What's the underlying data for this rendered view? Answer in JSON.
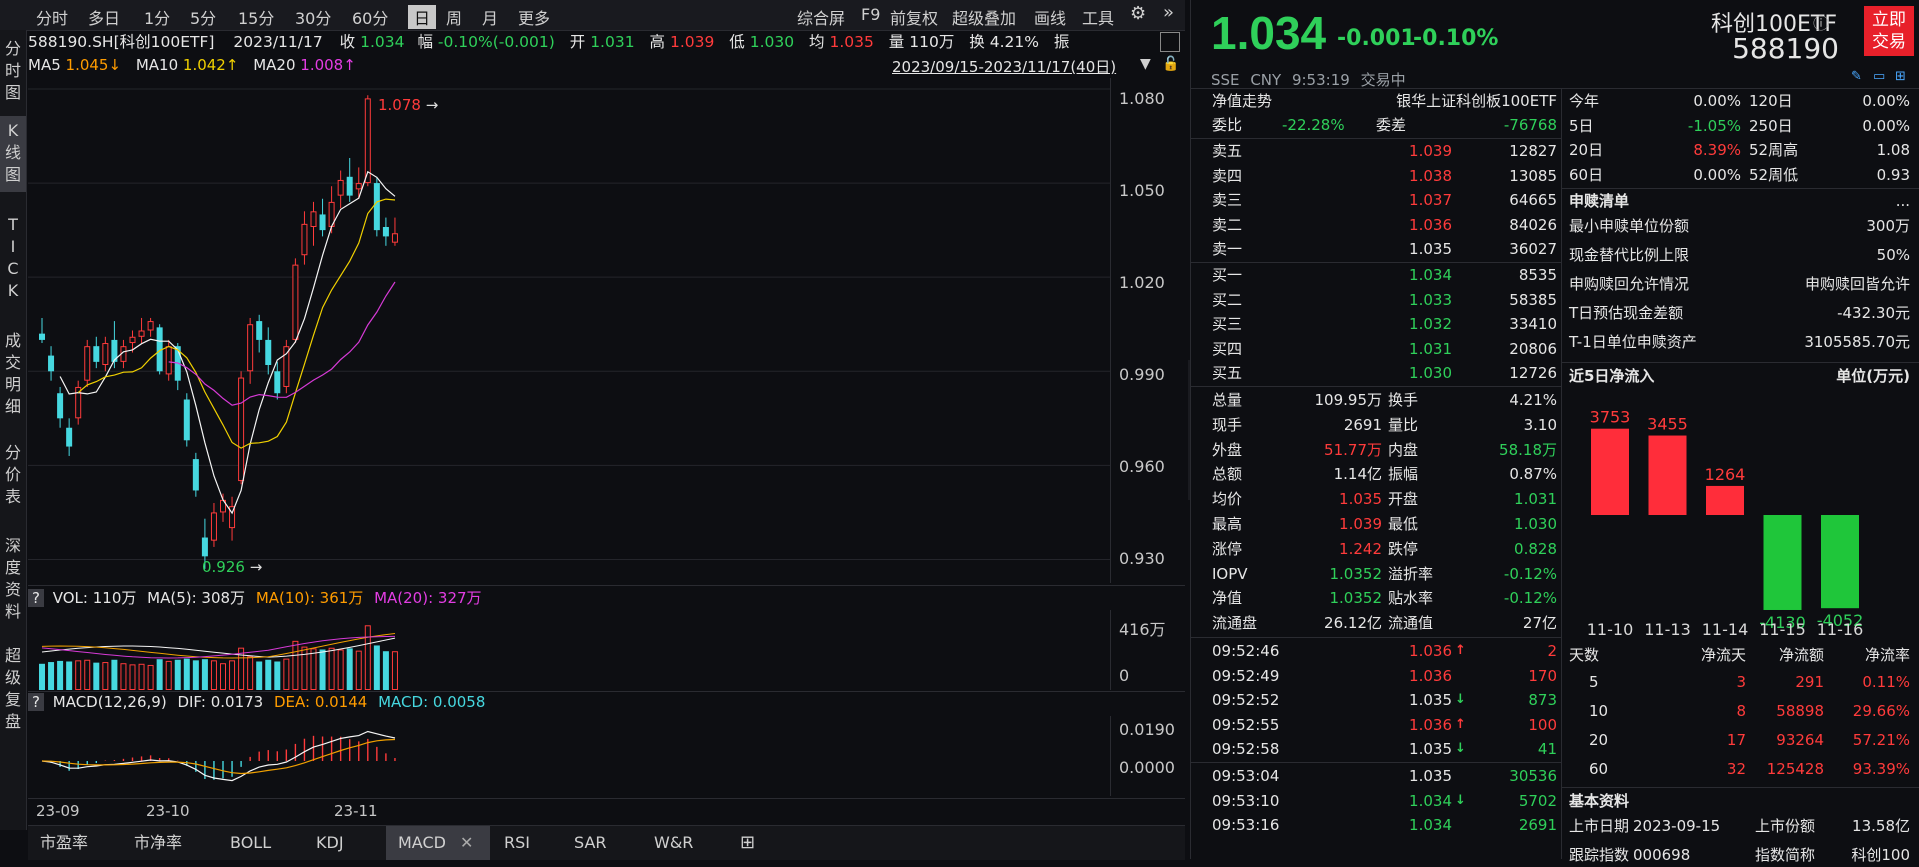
{
  "toolbar": {
    "periods": [
      "分时",
      "多日",
      "1分",
      "5分",
      "15分",
      "30分",
      "60分",
      "日",
      "周",
      "月",
      "更多"
    ],
    "active_period": "日",
    "right_tools": [
      "综合屏",
      "F9",
      "前复权",
      "超级叠加",
      "画线",
      "工具"
    ]
  },
  "sidebar": [
    "分时图",
    "K线图",
    "TICK",
    "成交明细",
    "分价表",
    "深度资料",
    "超级复盘"
  ],
  "sidebar_active": "K线图",
  "info": {
    "code": "588190.SH[科创100ETF]",
    "date": "2023/11/17",
    "close_label": "收",
    "close": "1.034",
    "change_label": "幅",
    "change": "-0.10%(-0.001)",
    "open_label": "开",
    "open": "1.031",
    "high_label": "高",
    "high": "1.039",
    "low_label": "低",
    "low": "1.030",
    "avg_label": "均",
    "avg": "1.035",
    "vol_label": "量",
    "vol": "110万",
    "turnover_label": "换",
    "turnover": "4.21%",
    "amp_label": "振"
  },
  "ma": {
    "ma5_label": "MA5",
    "ma5": "1.045↓",
    "ma10_label": "MA10",
    "ma10": "1.042↑",
    "ma20_label": "MA20",
    "ma20": "1.008↑",
    "range": "2023/09/15-2023/11/17(40日)"
  },
  "yaxis": [
    "1.080",
    "1.050",
    "1.020",
    "0.990",
    "0.960",
    "0.930"
  ],
  "high_marker": "1.078",
  "low_marker": "0.926",
  "vol_header": {
    "q": "?",
    "vol": "VOL: 110万",
    "ma5": "MA(5): 308万",
    "ma10": "MA(10): 361万",
    "ma20": "MA(20): 327万"
  },
  "vol_axis": [
    "416万",
    "0"
  ],
  "macd_header": {
    "q": "?",
    "name": "MACD(12,26,9)",
    "dif": "DIF: 0.0173",
    "dea": "DEA: 0.0144",
    "macd": "MACD: 0.0058"
  },
  "macd_axis": [
    "0.0190",
    "0.0000"
  ],
  "xaxis": [
    "23-09",
    "23-10",
    "23-11"
  ],
  "bottom_tabs": [
    "市盈率",
    "市净率",
    "BOLL",
    "KDJ",
    "MACD",
    "RSI",
    "SAR",
    "W&R"
  ],
  "bottom_active": "MACD",
  "quote": {
    "price": "1.034",
    "change": "-0.001",
    "pct": "-0.10%",
    "name": "科创100ETF",
    "code": "588190",
    "trade_btn": "立即交易",
    "exchange": "SSE",
    "currency": "CNY",
    "time": "9:53:19",
    "status": "交易中"
  },
  "nav_label": "净值走势",
  "index_name": "银华上证科创板100ETF",
  "weibi": {
    "label": "委比",
    "value": "-22.28%",
    "label2": "委差",
    "value2": "-76768"
  },
  "asks": [
    {
      "label": "卖五",
      "price": "1.039",
      "vol": "12827"
    },
    {
      "label": "卖四",
      "price": "1.038",
      "vol": "13085"
    },
    {
      "label": "卖三",
      "price": "1.037",
      "vol": "64665"
    },
    {
      "label": "卖二",
      "price": "1.036",
      "vol": "84026"
    },
    {
      "label": "卖一",
      "price": "1.035",
      "vol": "36027"
    }
  ],
  "bids": [
    {
      "label": "买一",
      "price": "1.034",
      "vol": "8535"
    },
    {
      "label": "买二",
      "price": "1.033",
      "vol": "58385"
    },
    {
      "label": "买三",
      "price": "1.032",
      "vol": "33410"
    },
    {
      "label": "买四",
      "price": "1.031",
      "vol": "20806"
    },
    {
      "label": "买五",
      "price": "1.030",
      "vol": "12726"
    }
  ],
  "stats": [
    {
      "l1": "总量",
      "v1": "109.95万",
      "l2": "换手",
      "v2": "4.21%"
    },
    {
      "l1": "现手",
      "v1": "2691",
      "l2": "量比",
      "v2": "3.10"
    },
    {
      "l1": "外盘",
      "v1": "51.77万",
      "l2": "内盘",
      "v2": "58.18万"
    },
    {
      "l1": "总额",
      "v1": "1.14亿",
      "l2": "振幅",
      "v2": "0.87%"
    },
    {
      "l1": "均价",
      "v1": "1.035",
      "l2": "开盘",
      "v2": "1.031"
    },
    {
      "l1": "最高",
      "v1": "1.039",
      "l2": "最低",
      "v2": "1.030"
    },
    {
      "l1": "涨停",
      "v1": "1.242",
      "l2": "跌停",
      "v2": "0.828"
    },
    {
      "l1": "IOPV",
      "v1": "1.0352",
      "l2": "溢折率",
      "v2": "-0.12%"
    },
    {
      "l1": "净值",
      "v1": "1.0352",
      "l2": "贴水率",
      "v2": "-0.12%"
    },
    {
      "l1": "流通盘",
      "v1": "26.12亿",
      "l2": "流通值",
      "v2": "27亿"
    }
  ],
  "ticks": [
    {
      "time": "09:52:46",
      "price": "1.036",
      "arrow": "↑",
      "vol": "2"
    },
    {
      "time": "09:52:49",
      "price": "1.036",
      "arrow": "",
      "vol": "170"
    },
    {
      "time": "09:52:52",
      "price": "1.035",
      "arrow": "↓",
      "vol": "873"
    },
    {
      "time": "09:52:55",
      "price": "1.036",
      "arrow": "↑",
      "vol": "100"
    },
    {
      "time": "09:52:58",
      "price": "1.035",
      "arrow": "↓",
      "vol": "41"
    },
    {
      "time": "09:53:04",
      "price": "1.035",
      "arrow": "",
      "vol": "30536"
    },
    {
      "time": "09:53:10",
      "price": "1.034",
      "arrow": "↓",
      "vol": "5702"
    },
    {
      "time": "09:53:16",
      "price": "1.034",
      "arrow": "",
      "vol": "2691"
    }
  ],
  "perf": [
    {
      "l1": "今年",
      "v1": "0.00%",
      "l2": "120日",
      "v2": "0.00%"
    },
    {
      "l1": "5日",
      "v1": "-1.05%",
      "l2": "250日",
      "v2": "0.00%"
    },
    {
      "l1": "20日",
      "v1": "8.39%",
      "l2": "52周高",
      "v2": "1.08"
    },
    {
      "l1": "60日",
      "v1": "0.00%",
      "l2": "52周低",
      "v2": "0.93"
    }
  ],
  "subscription": {
    "title": "申赎清单",
    "more": "...",
    "rows": [
      {
        "label": "最小申赎单位份额",
        "value": "300万"
      },
      {
        "label": "现金替代比例上限",
        "value": "50%"
      },
      {
        "label": "申购赎回允许情况",
        "value": "申购赎回皆允许"
      },
      {
        "label": "T日预估现金差额",
        "value": "-432.30元"
      },
      {
        "label": "T-1日单位申赎资产",
        "value": "3105585.70元"
      }
    ]
  },
  "netflow": {
    "title": "近5日净流入",
    "unit": "单位(万元)",
    "chart_data": {
      "type": "bar",
      "categories": [
        "11-10",
        "11-13",
        "11-14",
        "11-15",
        "11-16"
      ],
      "values": [
        3753,
        3455,
        1264,
        -4130,
        -4052
      ]
    }
  },
  "flow_table": {
    "headers": [
      "天数",
      "净流天",
      "净流额",
      "净流率"
    ],
    "rows": [
      [
        "5",
        "3",
        "291",
        "0.11%"
      ],
      [
        "10",
        "8",
        "58898",
        "29.66%"
      ],
      [
        "20",
        "17",
        "93264",
        "57.21%"
      ],
      [
        "60",
        "32",
        "125428",
        "93.39%"
      ]
    ]
  },
  "basic": {
    "title": "基本资料",
    "rows": [
      {
        "l1": "上市日期",
        "v1": "2023-09-15",
        "l2": "上市份额",
        "v2": "13.58亿"
      },
      {
        "l1": "跟踪指数",
        "v1": "000698",
        "l2": "指数简称",
        "v2": "科创100"
      }
    ]
  },
  "candle_data": [
    [
      1.002,
      1.0,
      1.007,
      0.999
    ],
    [
      0.995,
      0.99,
      0.998,
      0.987
    ],
    [
      0.983,
      0.975,
      0.985,
      0.972
    ],
    [
      0.972,
      0.966,
      0.975,
      0.963
    ],
    [
      0.975,
      0.985,
      0.987,
      0.973
    ],
    [
      0.987,
      0.998,
      1.0,
      0.985
    ],
    [
      0.998,
      0.993,
      1.001,
      0.991
    ],
    [
      0.992,
      0.999,
      1.001,
      0.99
    ],
    [
      1.0,
      0.993,
      1.006,
      0.991
    ],
    [
      0.993,
      0.998,
      1.0,
      0.991
    ],
    [
      0.999,
      1.001,
      1.003,
      0.996
    ],
    [
      1.001,
      1.003,
      1.007,
      0.999
    ],
    [
      1.003,
      1.006,
      1.007,
      1.001
    ],
    [
      1.004,
      0.99,
      1.005,
      0.989
    ],
    [
      0.989,
      0.998,
      1.0,
      0.987
    ],
    [
      0.998,
      0.987,
      0.999,
      0.984
    ],
    [
      0.981,
      0.968,
      0.983,
      0.966
    ],
    [
      0.962,
      0.952,
      0.964,
      0.95
    ],
    [
      0.937,
      0.931,
      0.943,
      0.927
    ],
    [
      0.936,
      0.945,
      0.948,
      0.934
    ],
    [
      0.945,
      0.949,
      0.951,
      0.942
    ],
    [
      0.94,
      0.947,
      0.95,
      0.936
    ],
    [
      0.955,
      0.988,
      0.99,
      0.954
    ],
    [
      0.99,
      1.005,
      1.007,
      0.986
    ],
    [
      1.006,
      1.0,
      1.008,
      0.996
    ],
    [
      1.0,
      0.992,
      1.004,
      0.989
    ],
    [
      0.99,
      0.983,
      0.993,
      0.981
    ],
    [
      0.985,
      0.998,
      1.0,
      0.983
    ],
    [
      1.0,
      1.024,
      1.026,
      0.999
    ],
    [
      1.027,
      1.037,
      1.041,
      1.024
    ],
    [
      1.036,
      1.041,
      1.044,
      1.03
    ],
    [
      1.04,
      1.035,
      1.045,
      1.033
    ],
    [
      1.036,
      1.044,
      1.049,
      1.034
    ],
    [
      1.046,
      1.051,
      1.054,
      1.042
    ],
    [
      1.052,
      1.046,
      1.058,
      1.044
    ],
    [
      1.048,
      1.05,
      1.055,
      1.045
    ],
    [
      1.05,
      1.077,
      1.078,
      1.049
    ],
    [
      1.05,
      1.035,
      1.052,
      1.033
    ],
    [
      1.036,
      1.033,
      1.039,
      1.03
    ],
    [
      1.031,
      1.034,
      1.039,
      1.03
    ]
  ]
}
